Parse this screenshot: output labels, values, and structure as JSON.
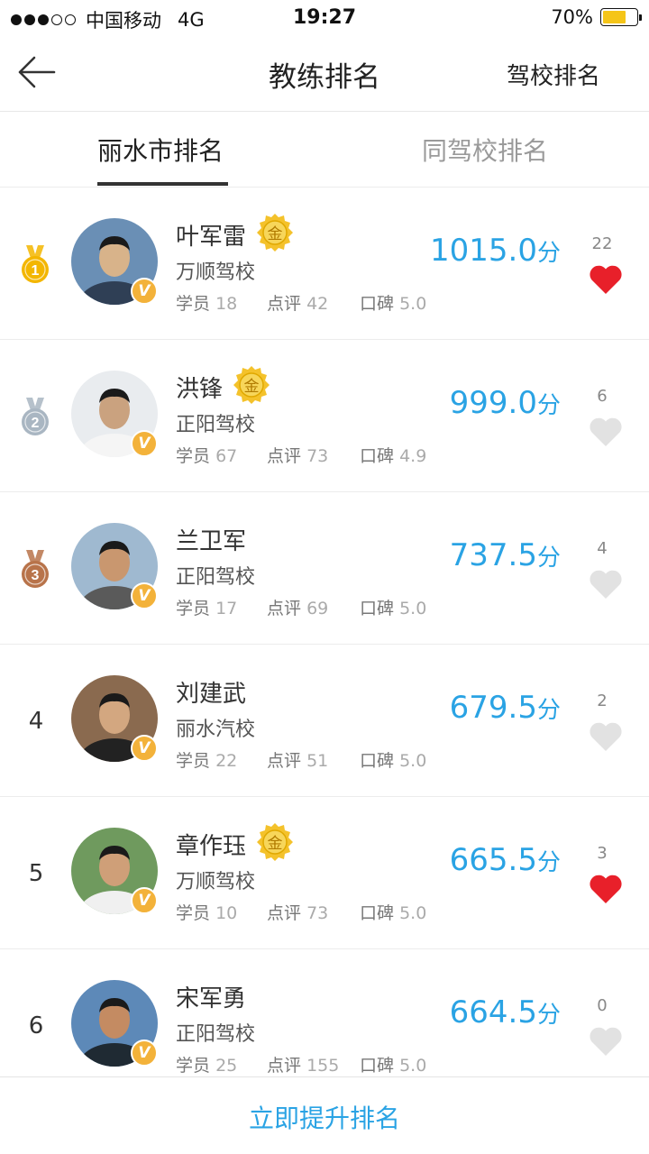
{
  "status_bar": {
    "carrier": "中国移动",
    "network": "4G",
    "time": "19:27",
    "battery_text": "70%",
    "battery_level": 0.7,
    "signal_bars_filled": 3,
    "signal_bars_total": 5,
    "battery_color": "#f5c518"
  },
  "nav": {
    "title": "教练排名",
    "right_label": "驾校排名",
    "back_icon": "back-arrow-icon"
  },
  "tabs": [
    {
      "label": "丽水市排名",
      "active": true
    },
    {
      "label": "同驾校排名",
      "active": false
    }
  ],
  "labels": {
    "students": "学员",
    "reviews": "点评",
    "reputation": "口碑",
    "score_unit": "分",
    "gold_badge": "金",
    "v_badge": "V"
  },
  "coaches": [
    {
      "rank": "1",
      "medal": "gold",
      "name": "叶军雷",
      "gold_badge": true,
      "school": "万顺驾校",
      "students": "18",
      "reviews": "42",
      "reputation": "5.0",
      "score": "1015.0",
      "likes": "22",
      "liked": true
    },
    {
      "rank": "2",
      "medal": "silver",
      "name": "洪锋",
      "gold_badge": true,
      "school": "正阳驾校",
      "students": "67",
      "reviews": "73",
      "reputation": "4.9",
      "score": "999.0",
      "likes": "6",
      "liked": false
    },
    {
      "rank": "3",
      "medal": "bronze",
      "name": "兰卫军",
      "gold_badge": false,
      "school": "正阳驾校",
      "students": "17",
      "reviews": "69",
      "reputation": "5.0",
      "score": "737.5",
      "likes": "4",
      "liked": false
    },
    {
      "rank": "4",
      "medal": "",
      "name": "刘建武",
      "gold_badge": false,
      "school": "丽水汽校",
      "students": "22",
      "reviews": "51",
      "reputation": "5.0",
      "score": "679.5",
      "likes": "2",
      "liked": false
    },
    {
      "rank": "5",
      "medal": "",
      "name": "章作珏",
      "gold_badge": true,
      "school": "万顺驾校",
      "students": "10",
      "reviews": "73",
      "reputation": "5.0",
      "score": "665.5",
      "likes": "3",
      "liked": true
    },
    {
      "rank": "6",
      "medal": "",
      "name": "宋军勇",
      "gold_badge": false,
      "school": "正阳驾校",
      "students": "25",
      "reviews": "155",
      "reputation": "5.0",
      "score": "664.5",
      "likes": "0",
      "liked": false
    }
  ],
  "bottom": {
    "button_label": "立即提升排名"
  },
  "colors": {
    "accent": "#2aa3e4",
    "liked_heart": "#e8202a",
    "unliked_heart": "#e2e2e2",
    "gold": "#f3b600",
    "silver": "#a9b6c2",
    "bronze": "#b8734a"
  }
}
